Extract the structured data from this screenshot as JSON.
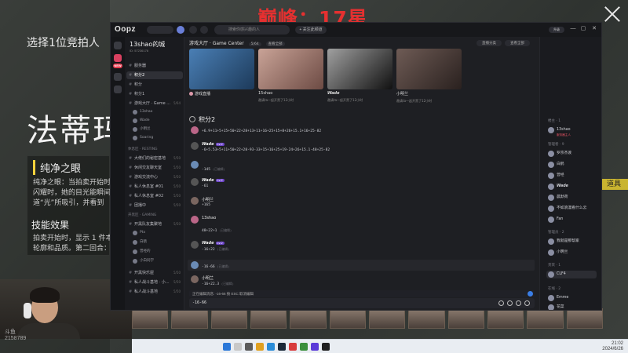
{
  "banner": "巅峰：17星",
  "game": {
    "choose_text": "选择1位竞拍人",
    "big_name": "法蒂玛",
    "skill_title": "纯净之眼",
    "skill_lines": [
      "纯净之眼：当拍卖开始时，",
      "闪耀时，她的目光能瞬间",
      "道“光”所吸引，并看到"
    ],
    "effect_title": "技能效果",
    "effect_lines": [
      "拍卖开始时，显示 1 件本",
      "轮廓和品质。第二回合："
    ],
    "tool_label": "道具"
  },
  "webcam": {
    "brand": "斗鱼",
    "room": "2158789"
  },
  "taskbar": {
    "time": "21:02",
    "date": "2024/6/26"
  },
  "oopz": {
    "logo": "Oopz",
    "search_placeholder": "搜索你感兴趣的人",
    "follow_label": "+ 关注此频道",
    "upgrade_label": "升级",
    "window_controls": [
      "—",
      "▢",
      "✕"
    ],
    "rail_new": "NEW",
    "server": {
      "name": "13shao的城",
      "id": "ID: 57236178"
    },
    "channels": [
      {
        "label": "服务器",
        "count": ""
      },
      {
        "label": "积分2",
        "count": "",
        "active": true
      },
      {
        "label": "积分",
        "count": ""
      },
      {
        "label": "积分1",
        "count": ""
      },
      {
        "label": "游戏大厅 · Game ...",
        "count": "5/64"
      }
    ],
    "channel_users": [
      "13shao",
      "Wade",
      "小明兰",
      "Soaring"
    ],
    "cat_resting": "休息区 · RESTING",
    "resting_channels": [
      {
        "label": "大佬们的秘密基地",
        "count": "5/50"
      },
      {
        "label": "休闲交友聊天室",
        "count": "5/50"
      },
      {
        "label": "游戏交流中心",
        "count": "5/50"
      },
      {
        "label": "私人休息室 #01",
        "count": "5/50"
      },
      {
        "label": "私人休息室 #02",
        "count": "5/50"
      },
      {
        "label": "团播中",
        "count": "5/50"
      }
    ],
    "cat_gaming": "开黑区 · GAMING",
    "gaming_channels": [
      {
        "label": "开黑队友集聚地",
        "count": "5/50"
      }
    ],
    "gaming_users": [
      "Ptx",
      "白鹤",
      "曾经的",
      "小白同学"
    ],
    "gaming_channels_2": [
      {
        "label": "开黑快乐屋",
        "count": "5/50"
      },
      {
        "label": "私人战斗基地 · 小...",
        "count": "5/50"
      },
      {
        "label": "私人战斗基地",
        "count": "5/50"
      }
    ],
    "game_center": {
      "label": "游戏大厅 · Game Center",
      "count": "5/64",
      "badge": "查看全部",
      "btn_rank": "直播分类",
      "btn_more": "查看全部"
    },
    "cards": [
      {
        "title": "游戏直播",
        "sub": "",
        "color1": "#4a7fb5",
        "color2": "#1d3a5a"
      },
      {
        "title": "15shao",
        "sub": "邀请ta一起开黑了12小时",
        "color1": "#c9a397",
        "color2": "#6d4b44"
      },
      {
        "title": "Wade",
        "sub": "邀请ta一起开黑了12小时",
        "color1": "#a0a0a0",
        "color2": "#111111"
      },
      {
        "title": "小明兰",
        "sub": "邀请ta一起开黑了12小时",
        "color1": "#6e5b55",
        "color2": "#2a211f"
      }
    ],
    "channel_title": "积分2",
    "messages": [
      {
        "name": "",
        "text": "+6.9+11+5+15+50+22+28+13+11+16+25+15+8+26+15.1+16+25-82",
        "avatar": "#b68"
      },
      {
        "name": "Wade",
        "lv": "Lv.2",
        "text": "-6+5.53+5+11+50+22+28-93-33+15+16+25+19-24+26+15.1-48+25-82",
        "avatar": "#555"
      },
      {
        "name": "",
        "text": "-145",
        "edited": "(已编辑)",
        "avatar": "#6a8bb5"
      },
      {
        "name": "Wade",
        "lv": "Lv.2",
        "text": "-61",
        "avatar": "#555"
      },
      {
        "name": "小明兰",
        "text": "+165",
        "avatar": "#7a6660"
      },
      {
        "name": "13shao",
        "text": "48+22+1",
        "edited": "(已编辑)",
        "avatar": "#b68"
      },
      {
        "name": "Wade",
        "lv": "Lv.2",
        "text": "-16+22",
        "edited": "(已编辑)",
        "avatar": "#555"
      },
      {
        "name": "",
        "text": "-16-66",
        "edited": "(已编辑)",
        "avatar": "#6a8bb5"
      },
      {
        "name": "小明兰",
        "text": "-16+22.3",
        "edited": "(已编辑)",
        "avatar": "#7a6660"
      }
    ],
    "reply_label": "正在编辑消息: -16-66   按 ESC 取消编辑",
    "composer_value": "-16-66",
    "members": {
      "owner_cat": "楼主 · 1",
      "owner": {
        "name": "13shao",
        "sub": "服务器主人"
      },
      "admin_cat": "管理者 · 9",
      "admins": [
        "罗宗杰诶",
        "白鹤",
        "曾经",
        "Wade",
        "晨默荷",
        "不如浪漫看什么云",
        "Fan"
      ],
      "vip_cat": "管理员 · 2",
      "vips": [
        "我就是那帮家",
        "小明兰"
      ],
      "guest_cat": "贵宾 · 1",
      "guests": [
        "CLF4"
      ],
      "online_cat": "在线 · 2",
      "online": [
        "Emme",
        "花菜"
      ]
    }
  }
}
